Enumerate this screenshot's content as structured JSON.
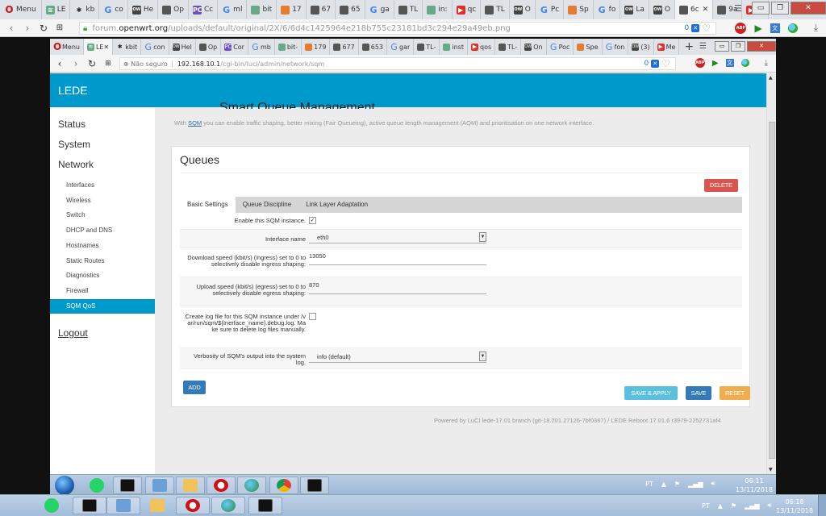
{
  "outer_browser": {
    "menu_label": "Menu",
    "tabs": [
      {
        "icon": "lede-icon",
        "label": "LE"
      },
      {
        "icon": "robot-icon",
        "label": "kb"
      },
      {
        "icon": "google-icon",
        "label": "co"
      },
      {
        "icon": "openwrt-icon",
        "label": "He"
      },
      {
        "icon": "doc-icon",
        "label": "Op"
      },
      {
        "icon": "pc-icon",
        "label": "Cc"
      },
      {
        "icon": "google-icon",
        "label": "ml"
      },
      {
        "icon": "bit-icon",
        "label": "bit"
      },
      {
        "icon": "puzzle-icon",
        "label": "17"
      },
      {
        "icon": "doc-icon",
        "label": "67"
      },
      {
        "icon": "doc-icon",
        "label": "65"
      },
      {
        "icon": "google-icon",
        "label": "ga"
      },
      {
        "icon": "doc-icon",
        "label": "TL"
      },
      {
        "icon": "ins-icon",
        "label": "in:"
      },
      {
        "icon": "youtube-icon",
        "label": "qc"
      },
      {
        "icon": "doc-icon",
        "label": "TL"
      },
      {
        "icon": "openwrt-icon",
        "label": "O"
      },
      {
        "icon": "google-icon",
        "label": "Pc"
      },
      {
        "icon": "puzzle-icon",
        "label": "Sp"
      },
      {
        "icon": "google-icon",
        "label": "fo"
      },
      {
        "icon": "openwrt-icon",
        "label": "La"
      },
      {
        "icon": "openwrt-icon",
        "label": "O"
      },
      {
        "icon": "doc-icon",
        "label": "6c",
        "active": true
      },
      {
        "icon": "doc-icon",
        "label": "9a"
      },
      {
        "icon": "youtube-icon",
        "label": "M"
      }
    ],
    "url_host_prefix": "forum.",
    "url_host": "openwrt.org",
    "url_path": "/uploads/default/original/2X/6/6d4c1425964e218b755c23181bd3c294e29a49eb.png",
    "badge_count": "0"
  },
  "inner_browser": {
    "menu_label": "Menu",
    "tabs": [
      {
        "icon": "lede-icon",
        "label": "LE",
        "active": true
      },
      {
        "icon": "robot-icon",
        "label": "kbit"
      },
      {
        "icon": "google-icon",
        "label": "con"
      },
      {
        "icon": "openwrt-icon",
        "label": "Hel"
      },
      {
        "icon": "doc-icon",
        "label": "Op"
      },
      {
        "icon": "pc-icon",
        "label": "Cor"
      },
      {
        "icon": "google-icon",
        "label": "mb"
      },
      {
        "icon": "bit-icon",
        "label": "bit-"
      },
      {
        "icon": "puzzle-icon",
        "label": "179"
      },
      {
        "icon": "doc-icon",
        "label": "677"
      },
      {
        "icon": "doc-icon",
        "label": "653"
      },
      {
        "icon": "google-icon",
        "label": "gar"
      },
      {
        "icon": "doc-icon",
        "label": "TL-"
      },
      {
        "icon": "ins-icon",
        "label": "inst"
      },
      {
        "icon": "youtube-icon",
        "label": "qos"
      },
      {
        "icon": "doc-icon",
        "label": "TL-"
      },
      {
        "icon": "openwrt-icon",
        "label": "On"
      },
      {
        "icon": "google-icon",
        "label": "Poc"
      },
      {
        "icon": "puzzle-icon",
        "label": "Spe"
      },
      {
        "icon": "google-icon",
        "label": "fon"
      },
      {
        "icon": "openwrt-icon",
        "label": "(3)"
      },
      {
        "icon": "youtube-icon",
        "label": "Me"
      }
    ],
    "security_label": "Não seguro",
    "url_host": "192.168.10.1",
    "url_path": "/cgi-bin/luci/admin/network/sqm",
    "badge_count": "0"
  },
  "luci": {
    "brand": "LEDE",
    "sidebar": {
      "top_items": [
        "Status",
        "System",
        "Network"
      ],
      "network_items": [
        {
          "label": "Interfaces"
        },
        {
          "label": "Wireless"
        },
        {
          "label": "Switch"
        },
        {
          "label": "DHCP and DNS"
        },
        {
          "label": "Hostnames"
        },
        {
          "label": "Static Routes"
        },
        {
          "label": "Diagnostics"
        },
        {
          "label": "Firewall"
        },
        {
          "label": "SQM QoS",
          "active": true
        }
      ],
      "logout": "Logout"
    },
    "intro_prefix": "With ",
    "intro_link": "SQM",
    "intro_suffix": " you can enable traffic shaping, better mixing (Fair Queueing), active queue length management (AQM) and prioritisation on one network interface.",
    "section_title": "Queues",
    "delete_label": "DELETE",
    "tabs": [
      "Basic Settings",
      "Queue Discipline",
      "Link Layer Adaptation"
    ],
    "active_tab": "Basic Settings",
    "fields": {
      "enable": {
        "label": "Enable this SQM instance.",
        "checked": true
      },
      "interface": {
        "label": "Interface name",
        "value": "eth0"
      },
      "download": {
        "label": "Download speed (kbit/s) (ingress) set to 0 to selectively disable ingress shaping:",
        "value": "13050"
      },
      "upload": {
        "label": "Upload speed (kbit/s) (egress) set to 0 to selectively disable egress shaping:",
        "value": "870"
      },
      "logfile": {
        "label": "Create log file for this SQM instance under /var/run/sqm/${Inerface_name}.debug.log. Make sure to delete log files manually.",
        "checked": false
      },
      "verbosity": {
        "label": "Verbosity of SQM's output into the system log.",
        "value": "info (default)"
      }
    },
    "add_label": "ADD",
    "save_apply_label": "SAVE & APPLY",
    "save_label": "SAVE",
    "reset_label": "RESET",
    "footer": "Powered by LuCI lede-17.01 branch (git-18.201.27126-7bf0367) / LEDE Reboot 17.01.6 r3979-2252731af4"
  },
  "taskbar_inner": {
    "apps": [
      "start",
      "whatsapp",
      "cmd",
      "calculator",
      "file-explorer",
      "opera",
      "idm",
      "chrome",
      "speedtest"
    ],
    "lang": "PT",
    "time": "06:11",
    "date": "13/11/2018"
  },
  "taskbar_outer": {
    "apps": [
      "whatsapp",
      "cmd",
      "calculator",
      "file-explorer",
      "opera",
      "idm",
      "speedtest"
    ],
    "lang": "PT",
    "time": "06:18",
    "date": "13/11/2018"
  },
  "colors": {
    "lede_blue": "#0099cc",
    "delete_red": "#d9534f",
    "primary_blue": "#337ab7",
    "info_cyan": "#5bc0de",
    "warning_orange": "#f0ad4e"
  }
}
